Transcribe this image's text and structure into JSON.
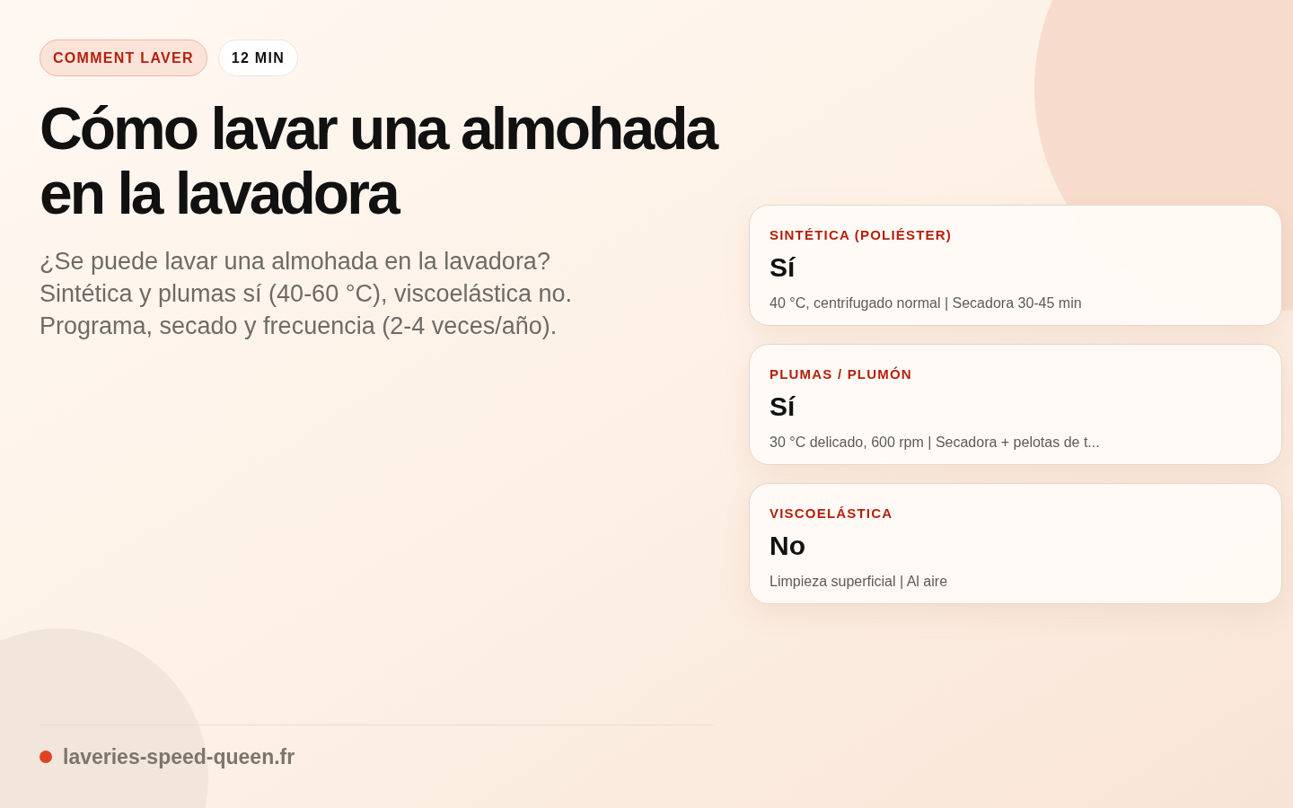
{
  "tags": [
    {
      "label": "COMMENT LAVER",
      "kind": "category"
    },
    {
      "label": "12 MIN",
      "kind": "duration"
    }
  ],
  "title": "Cómo lavar una almohada en la lavadora",
  "subtitle": "¿Se puede lavar una almohada en la lavadora? Sintética y plumas sí (40-60 °C), viscoelástica no. Programa, secado y frecuencia (2-4 veces/año).",
  "cards": [
    {
      "label": "SINTÉTICA (POLIÉSTER)",
      "answer": "Sí",
      "detail": "40 °C, centrifugado normal | Secadora 30-45 min"
    },
    {
      "label": "PLUMAS / PLUMÓN",
      "answer": "Sí",
      "detail": "30 °C delicado, 600 rpm | Secadora + pelotas de t..."
    },
    {
      "label": "VISCOELÁSTICA",
      "answer": "No",
      "detail": "Limpieza superficial | Al aire"
    }
  ],
  "footer": {
    "site": "laveries-speed-queen.fr"
  }
}
